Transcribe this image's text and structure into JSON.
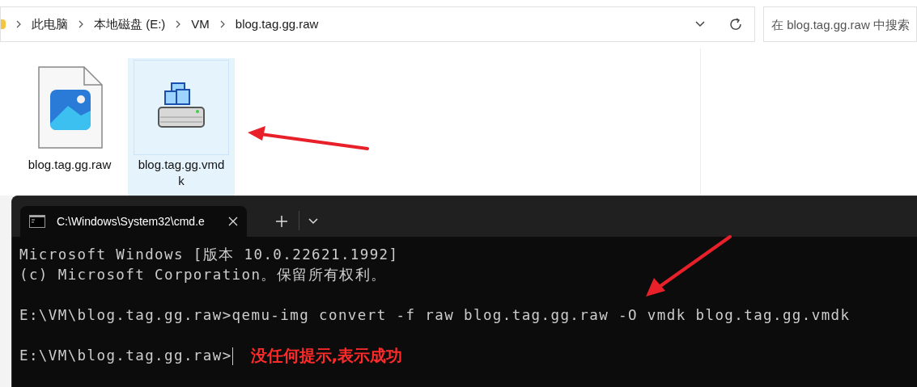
{
  "explorer": {
    "breadcrumbs": [
      "此电脑",
      "本地磁盘 (E:)",
      "VM",
      "blog.tag.gg.raw"
    ],
    "search": {
      "placeholder": "在 blog.tag.gg.raw 中搜索"
    },
    "files": [
      {
        "name": "blog.tag.gg.raw",
        "kind": "image",
        "selected": false
      },
      {
        "name": "blog.tag.gg.vmdk",
        "kind": "disk",
        "selected": true
      }
    ]
  },
  "terminal": {
    "tabs": [
      {
        "title": "C:\\Windows\\System32\\cmd.e",
        "selected": true
      }
    ],
    "blocks": [
      [
        "Microsoft Windows [版本 10.0.22621.1992]",
        "(c) Microsoft Corporation。保留所有权利。"
      ],
      [
        "E:\\VM\\blog.tag.gg.raw>qemu-img convert -f raw blog.tag.gg.raw -O vmdk blog.tag.gg.vmdk"
      ]
    ],
    "prompt": "E:\\VM\\blog.tag.gg.raw>"
  },
  "annotation": {
    "note": "没任何提示,表示成功"
  }
}
